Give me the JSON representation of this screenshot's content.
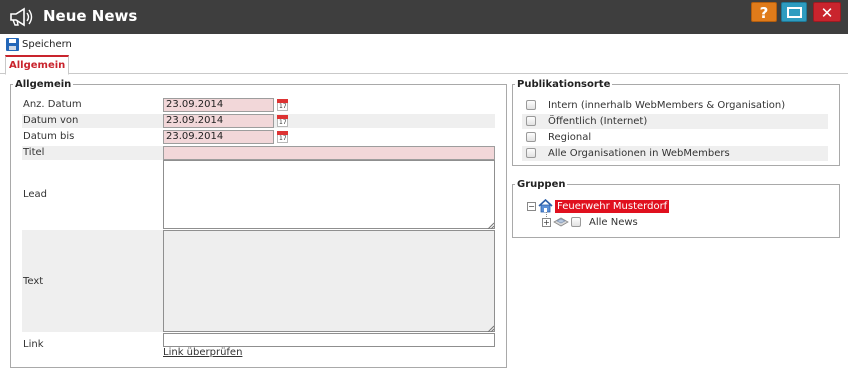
{
  "window": {
    "title": "Neue News",
    "help_label": "?",
    "close_label": "✕"
  },
  "toolbar": {
    "save_label": "Speichern"
  },
  "tabs": [
    {
      "label": "Allgemein",
      "active": true
    }
  ],
  "allgemein": {
    "legend": "Allgemein",
    "anz_datum": {
      "label": "Anz. Datum",
      "value": "23.09.2014"
    },
    "datum_von": {
      "label": "Datum von",
      "value": "23.09.2014"
    },
    "datum_bis": {
      "label": "Datum bis",
      "value": "23.09.2014"
    },
    "calendar_num": "17",
    "titel": {
      "label": "Titel",
      "value": ""
    },
    "lead": {
      "label": "Lead",
      "value": ""
    },
    "text": {
      "label": "Text",
      "value": ""
    },
    "link": {
      "label": "Link",
      "value": "",
      "check_label": "Link überprüfen"
    }
  },
  "publikationsorte": {
    "legend": "Publikationsorte",
    "items": [
      {
        "label": "Intern (innerhalb WebMembers & Organisation)",
        "checked": false
      },
      {
        "label": "Öffentlich (Internet)",
        "checked": false
      },
      {
        "label": "Regional",
        "checked": false
      },
      {
        "label": "Alle Organisationen in WebMembers",
        "checked": false
      }
    ]
  },
  "gruppen": {
    "legend": "Gruppen",
    "root_label": "Feuerwehr Musterdorf",
    "root_toggle": "−",
    "child_label": "Alle News",
    "child_toggle": "+"
  },
  "colors": {
    "accent": "#c9242d",
    "required_bg": "#f2d7d9",
    "titlebar": "#3e3e3e",
    "help": "#e07b1a",
    "maximize": "#2e9cc0",
    "selected_tree": "#e0101e"
  }
}
